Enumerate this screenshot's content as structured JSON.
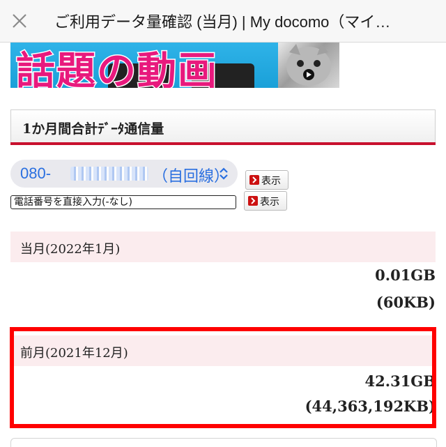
{
  "header": {
    "close_icon": "close-icon",
    "title": "ご利用データ量確認 (当月) | My docomo（マイ…"
  },
  "banner": {
    "text": "話題の動画"
  },
  "section": {
    "title": "1か月間合計ﾃﾞｰﾀ通信量"
  },
  "selector": {
    "number_prefix": "080-",
    "number_suffix": "（自回線）",
    "show_label": "表示"
  },
  "direct_input": {
    "placeholder": "電話番号を直接入力(-なし)",
    "show_label": "表示"
  },
  "months": [
    {
      "label": "当月(2022年1月)",
      "value_gb": "0.01GB",
      "value_kb": "(60KB)"
    },
    {
      "label": "前月(2021年12月)",
      "value_gb": "42.31GB",
      "value_kb": "(44,363,192KB)"
    }
  ],
  "colors": {
    "accent_red": "#c8102e",
    "highlight": "#ff0000",
    "link_blue": "#2a6fe0",
    "banner_pink": "#e8197d"
  }
}
